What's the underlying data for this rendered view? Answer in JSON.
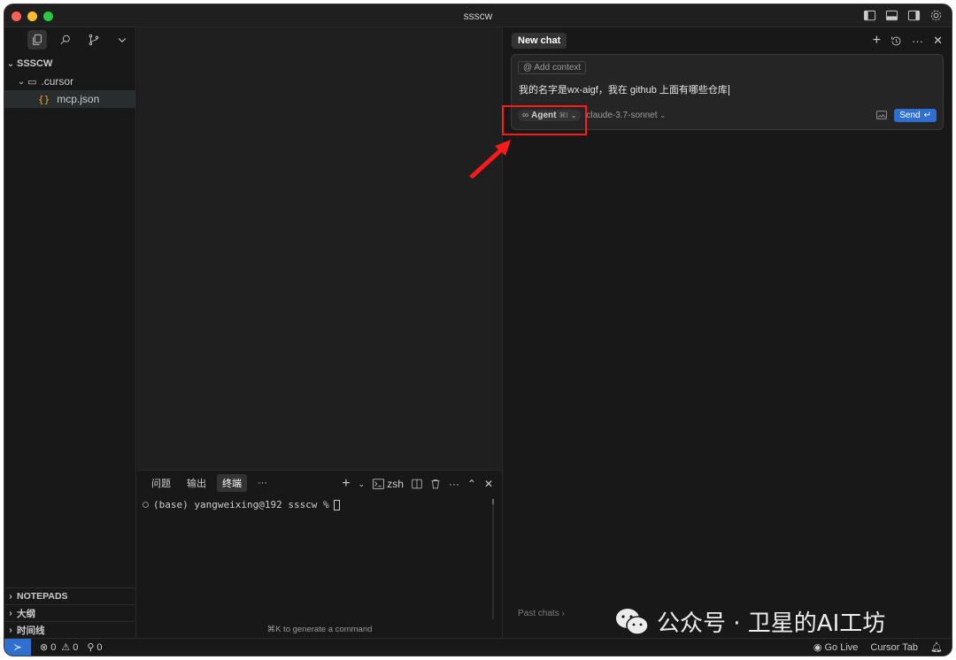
{
  "window": {
    "title": "ssscw"
  },
  "explorer": {
    "root_label": "SSSCW",
    "folder_label": ".cursor",
    "file_label": "mcp.json",
    "sections": [
      "NOTEPADS",
      "大纲",
      "时间线"
    ]
  },
  "terminal": {
    "tabs": [
      "问题",
      "输出",
      "终端",
      "···"
    ],
    "active_tab_index": 2,
    "shell_label": "zsh",
    "prompt_line": "(base) yangweixing@192 ssscw % ",
    "hint": "⌘K to generate a command"
  },
  "chat": {
    "tab_label": "New chat",
    "add_context": "Add context",
    "prompt_text": "我的名字是wx-aigf，我在 github 上面有哪些仓库",
    "mode_label": "Agent",
    "mode_shortcut": "⌘I",
    "model_label": "claude-3.7-sonnet",
    "send_label": "Send",
    "past_chats": "Past chats"
  },
  "watermark": {
    "text": "公众号 · 卫星的AI工坊"
  },
  "statusbar": {
    "errors": "0",
    "warnings": "0",
    "ports": "0",
    "go_live": "Go Live",
    "cursor_tab": "Cursor Tab"
  },
  "colors": {
    "accent": "#2f6fd0",
    "highlight": "#ff1a1a",
    "json_icon": "#e8a33d"
  }
}
